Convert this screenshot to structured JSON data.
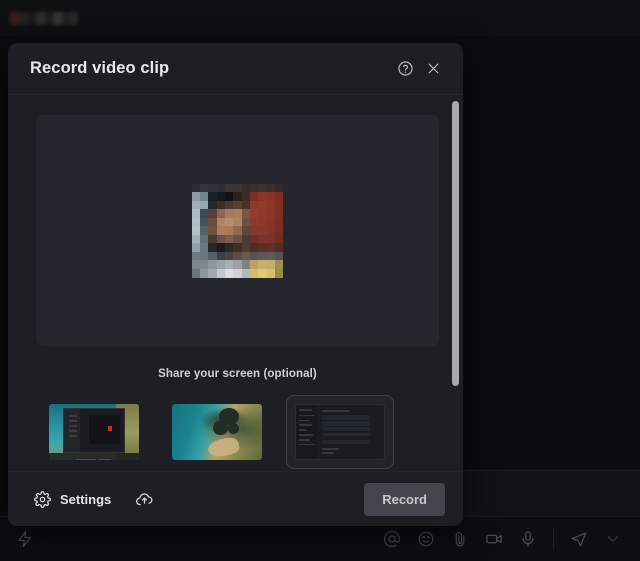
{
  "background_app": {
    "redacted_title": "",
    "bottom_toolbar": {
      "left_icons": [
        {
          "name": "lightning-bolt-icon",
          "glyph": "bolt"
        }
      ],
      "right_icons": [
        {
          "name": "mention-icon",
          "glyph": "at"
        },
        {
          "name": "emoji-icon",
          "glyph": "smiley"
        },
        {
          "name": "attachment-icon",
          "glyph": "paperclip"
        },
        {
          "name": "video-camera-icon",
          "glyph": "video"
        },
        {
          "name": "microphone-icon",
          "glyph": "mic"
        },
        {
          "name": "send-icon",
          "glyph": "plane"
        }
      ]
    }
  },
  "modal": {
    "title": "Record video clip",
    "help_label": "Help",
    "close_label": "Close",
    "preview": {
      "alt": "Camera preview (pixelated)",
      "pixels": [
        "#2b2f35",
        "#34383d",
        "#2f3238",
        "#2c2f34",
        "#3a3531",
        "#3d3632",
        "#352e2b",
        "#3a302c",
        "#3d322d",
        "#3a2f2b",
        "#332a27",
        "#8b9aa3",
        "#6f8590",
        "#1b1f24",
        "#15181c",
        "#121316",
        "#2a231f",
        "#3c2d26",
        "#7d2f26",
        "#8c352a",
        "#8a3329",
        "#7e2f26",
        "#9db1bb",
        "#92a8b3",
        "#22272c",
        "#3a2e27",
        "#4a372d",
        "#5a4034",
        "#4a3429",
        "#8c3a2d",
        "#93392c",
        "#8d352a",
        "#813026",
        "#a9bcc5",
        "#3c4a52",
        "#564038",
        "#8a6750",
        "#a67a5e",
        "#a97d60",
        "#7a5743",
        "#913d2f",
        "#8f392c",
        "#8a352a",
        "#7d3026",
        "#aec0c8",
        "#46535a",
        "#6a4f40",
        "#b08363",
        "#bb8c6a",
        "#b0835f",
        "#6e5140",
        "#8e3b2e",
        "#8c382b",
        "#863429",
        "#7a2f26",
        "#b2c3ca",
        "#576068",
        "#6d5243",
        "#a87c5e",
        "#a87b5c",
        "#8f6a50",
        "#5e453a",
        "#83382c",
        "#8a372b",
        "#843329",
        "#762e25",
        "#9fb0b8",
        "#63707a",
        "#4b3a32",
        "#6e5246",
        "#7d5c49",
        "#69503f",
        "#4a3a33",
        "#6e3129",
        "#7e332a",
        "#7c3228",
        "#6f2d24",
        "#8fa0a8",
        "#6a7680",
        "#24262a",
        "#191b1e",
        "#2e2622",
        "#3c2f28",
        "#4a3b33",
        "#4e2d28",
        "#5b2f29",
        "#5d3029",
        "#552c25",
        "#6e7a83",
        "#6b757e",
        "#565f67",
        "#3c4046",
        "#4a443f",
        "#5b4f45",
        "#6a5c4f",
        "#575357",
        "#5c585c",
        "#5d5a5d",
        "#555256",
        "#7b858d",
        "#7e888f",
        "#8f979d",
        "#9aa1a7",
        "#a8aeb3",
        "#9aa0a5",
        "#7d8389",
        "#bca55f",
        "#c7b067",
        "#c4ad64",
        "#a08e50",
        "#6b747c",
        "#8e979e",
        "#a3abb1",
        "#c2c8cc",
        "#d8dcdf",
        "#cfd3d6",
        "#b5babe",
        "#d4bd6e",
        "#e0c874",
        "#d8c06e",
        "#9c8a4c"
      ]
    },
    "share_section": {
      "label": "Share your screen (optional)",
      "thumbnails": [
        {
          "name": "screen-thumbnail-desktop",
          "alt": "Desktop with application window",
          "selected": false
        },
        {
          "name": "screen-thumbnail-photo",
          "alt": "Aerial coastline photo",
          "selected": false
        },
        {
          "name": "screen-thumbnail-app",
          "alt": "Dark application window",
          "selected": true
        }
      ]
    },
    "footer": {
      "settings_label": "Settings",
      "settings_icon": "gear-icon",
      "upload_icon": "cloud-upload-icon",
      "record_label": "Record"
    },
    "scrollbar": {
      "visible": true
    }
  },
  "colors": {
    "modal_bg": "#1d1f24",
    "preview_bg": "#24272d",
    "record_btn_bg": "#43464c",
    "record_btn_text": "#c6c9cd",
    "title_text": "#e6e8ea",
    "divider": "#24262b",
    "scrollbar_thumb": "#a6a9ad"
  }
}
